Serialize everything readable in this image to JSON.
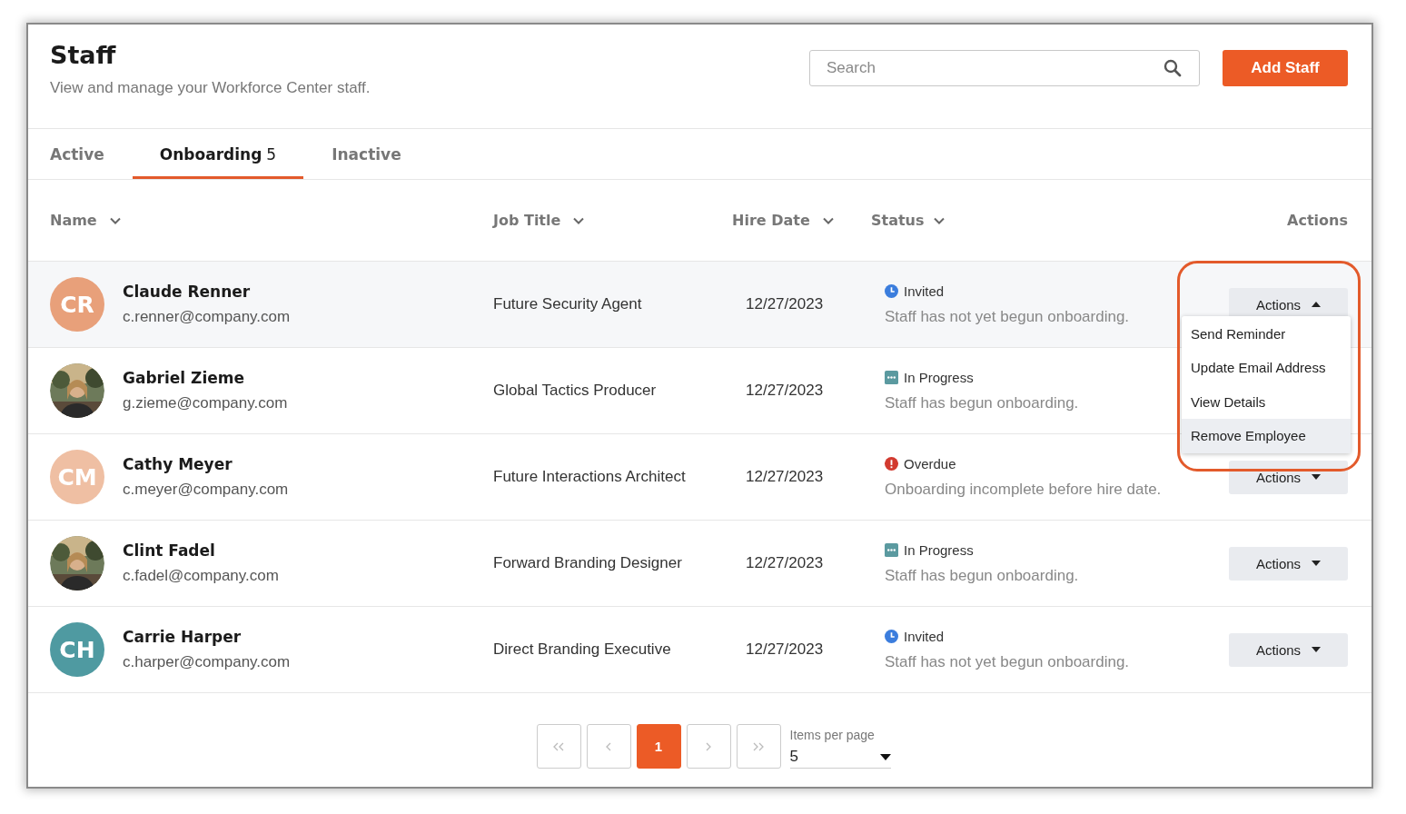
{
  "header": {
    "title": "Staff",
    "subtitle": "View and manage your Workforce Center staff.",
    "search": {
      "placeholder": "Search"
    },
    "add_button": "Add Staff"
  },
  "tabs": [
    {
      "label": "Active",
      "selected": false
    },
    {
      "label": "Onboarding",
      "count": "5",
      "selected": true
    },
    {
      "label": "Inactive",
      "selected": false
    }
  ],
  "columns": [
    {
      "label": "Name",
      "sortable": true
    },
    {
      "label": "Job Title",
      "sortable": true
    },
    {
      "label": "Hire Date",
      "sortable": true
    },
    {
      "label": "Status",
      "sortable": true
    },
    {
      "label": "Actions",
      "sortable": false
    }
  ],
  "rows": [
    {
      "avatar": {
        "kind": "initials",
        "initials": "CR",
        "color": "#e8a07a"
      },
      "name": "Claude Renner",
      "email": "c.renner@company.com",
      "job_title": "Future Security Agent",
      "hire_date": "12/27/2023",
      "status": {
        "kind": "invited",
        "label": "Invited",
        "note": "Staff has not yet begun onboarding."
      },
      "action": "Actions",
      "expanded": true,
      "highlighted": true
    },
    {
      "name": "Gabriel Zieme",
      "email": "g.zieme@company.com",
      "job_title": "Global Tactics Producer",
      "hire_date": "12/27/2023",
      "status": {
        "kind": "in_progress",
        "label": "In Progress",
        "note": "Staff has begun onboarding."
      },
      "expanded": false,
      "highlighted": false
    },
    {
      "avatar": {
        "kind": "initials",
        "initials": "CM",
        "color": "#efbfa3"
      },
      "name": "Cathy Meyer",
      "email": "c.meyer@company.com",
      "job_title": "Future Interactions Architect",
      "hire_date": "12/27/2023",
      "status": {
        "kind": "overdue",
        "label": "Overdue",
        "note": "Onboarding incomplete before hire date."
      },
      "action": "Actions",
      "expanded": false,
      "highlighted": false
    },
    {
      "name": "Clint Fadel",
      "email": "c.fadel@company.com",
      "job_title": "Forward Branding Designer",
      "hire_date": "12/27/2023",
      "status": {
        "kind": "in_progress",
        "label": "In Progress",
        "note": "Staff has begun onboarding."
      },
      "action": "Actions",
      "expanded": false,
      "highlighted": false
    },
    {
      "avatar": {
        "kind": "initials",
        "initials": "CH",
        "color": "#4f9aa1"
      },
      "name": "Carrie Harper",
      "email": "c.harper@company.com",
      "job_title": "Direct Branding Executive",
      "hire_date": "12/27/2023",
      "status": {
        "kind": "invited",
        "label": "Invited",
        "note": "Staff has not yet begun onboarding."
      },
      "action": "Actions",
      "expanded": false,
      "highlighted": false
    }
  ],
  "actions_menu": {
    "items": [
      {
        "label": "Send Reminder",
        "hovered": false
      },
      {
        "label": "Update Email Address",
        "hovered": false
      },
      {
        "label": "View Details",
        "hovered": false
      },
      {
        "label": "Remove Employee",
        "hovered": true
      }
    ]
  },
  "pagination": {
    "pages": [
      {
        "label": "1",
        "selected": true
      }
    ],
    "items_per_page_label": "Items per page",
    "items_per_page": "5"
  }
}
